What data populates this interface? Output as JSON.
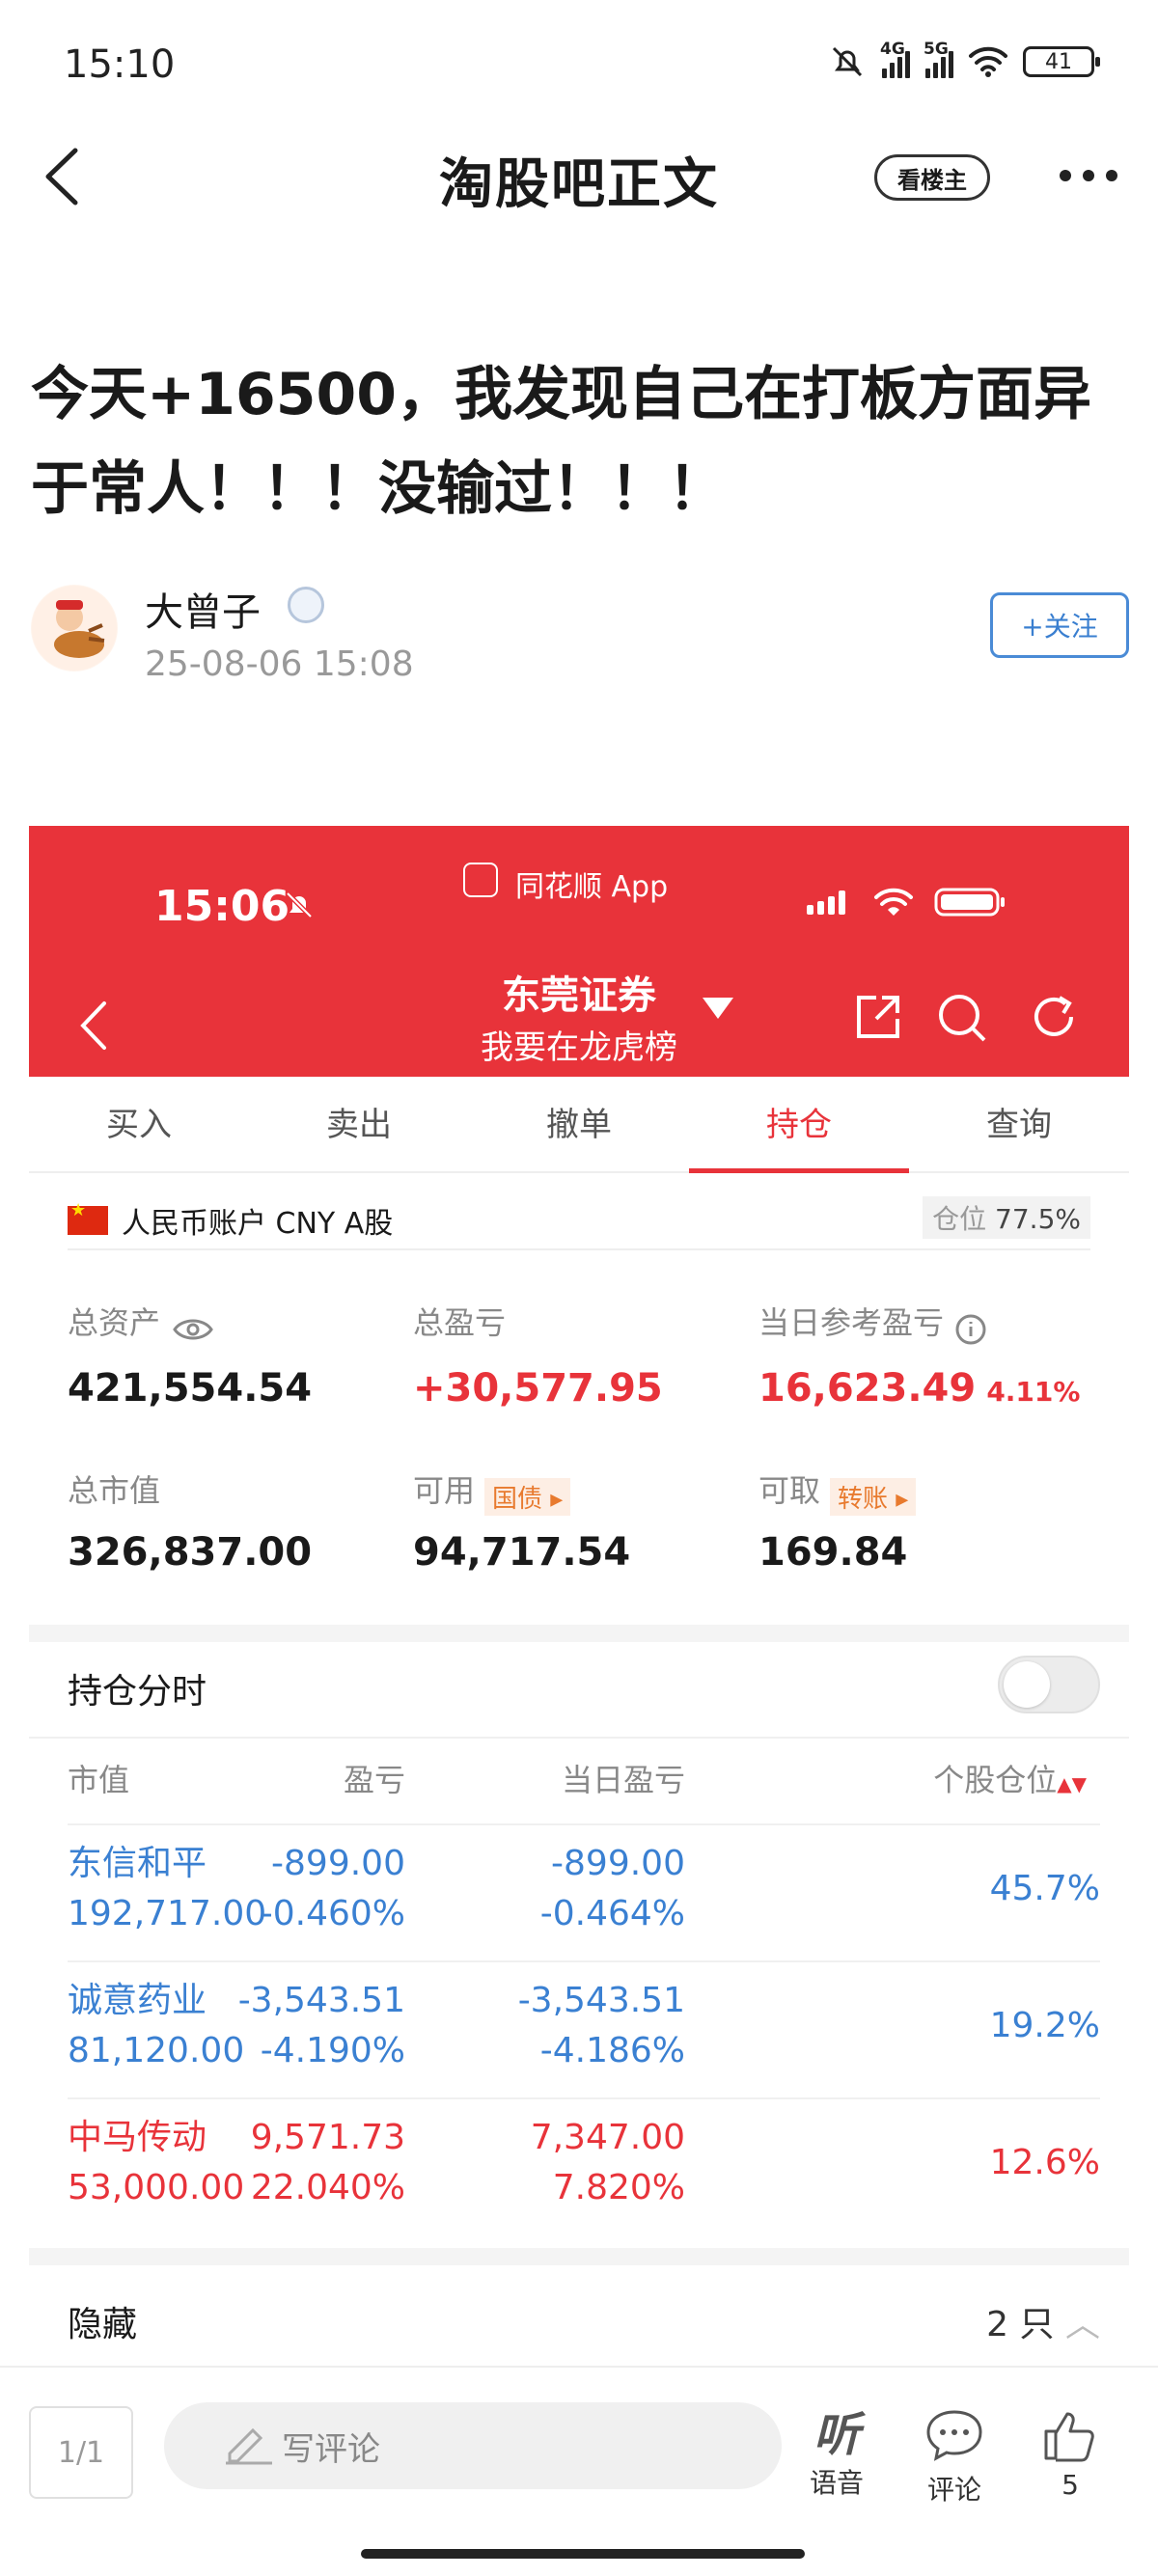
{
  "status_bar": {
    "time": "15:10",
    "net1": "4G",
    "net2": "5G",
    "battery": "41"
  },
  "header": {
    "title": "淘股吧正文",
    "op_only_label": "看楼主"
  },
  "post": {
    "title": "今天+16500，我发现自己在打板方面异于常人！！！没输过！！！",
    "author": "大曾子",
    "time": "25-08-06 15:08",
    "follow_label": "+关注"
  },
  "screenshot": {
    "status_time": "15:06",
    "app_name": "同花顺 App",
    "broker": "东莞证券",
    "broker_sub": "我要在龙虎榜",
    "tabs": [
      {
        "label": "买入",
        "active": false
      },
      {
        "label": "卖出",
        "active": false
      },
      {
        "label": "撤单",
        "active": false
      },
      {
        "label": "持仓",
        "active": true
      },
      {
        "label": "查询",
        "active": false
      }
    ],
    "account": {
      "label": "人民币账户 CNY A股",
      "position_label": "仓位",
      "position_value": "77.5%"
    },
    "summary": {
      "total_assets_label": "总资产",
      "total_assets": "421,554.54",
      "total_pnl_label": "总盈亏",
      "total_pnl": "+30,577.95",
      "today_pnl_label": "当日参考盈亏",
      "today_pnl": "16,623.49",
      "today_pnl_pct": "4.11%",
      "market_value_label": "总市值",
      "market_value": "326,837.00",
      "available_label": "可用",
      "available_tag": "国债",
      "available": "94,717.54",
      "withdrawable_label": "可取",
      "withdrawable_tag": "转账",
      "withdrawable": "169.84"
    },
    "intraday": {
      "label": "持仓分时",
      "enabled": false
    },
    "table": {
      "headers": [
        "市值",
        "盈亏",
        "当日盈亏",
        "个股仓位"
      ],
      "rows": [
        {
          "name": "东信和平",
          "mv": "192,717.00",
          "pnl": "-899.00",
          "pnl_pct": "-0.460%",
          "day_pnl": "-899.00",
          "day_pct": "-0.464%",
          "weight": "45.7%",
          "color": "#3a80d2"
        },
        {
          "name": "诚意药业",
          "mv": "81,120.00",
          "pnl": "-3,543.51",
          "pnl_pct": "-4.190%",
          "day_pnl": "-3,543.51",
          "day_pct": "-4.186%",
          "weight": "19.2%",
          "color": "#3a80d2"
        },
        {
          "name": "中马传动",
          "mv": "53,000.00",
          "pnl": "9,571.73",
          "pnl_pct": "22.040%",
          "day_pnl": "7,347.00",
          "day_pct": "7.820%",
          "weight": "12.6%",
          "color": "#e8333a"
        }
      ]
    },
    "hidden": {
      "label": "隐藏",
      "count": "2 只"
    }
  },
  "bottom_bar": {
    "page_indicator": "1/1",
    "comment_placeholder": "写评论",
    "listen_glyph": "听",
    "listen_label": "语音",
    "comment_label": "评论",
    "like_count": "5"
  }
}
